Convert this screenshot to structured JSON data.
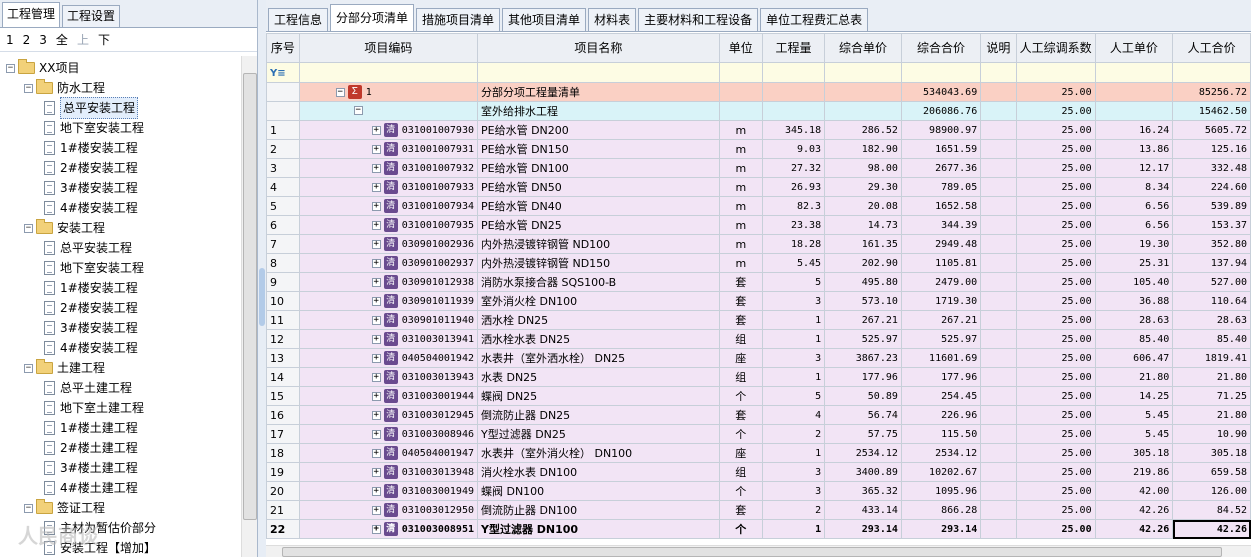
{
  "left_tabs": [
    "工程管理",
    "工程设置"
  ],
  "levels": [
    "1",
    "2",
    "3",
    "全",
    "上",
    "下"
  ],
  "tree": [
    {
      "label": "XX项目",
      "depth": 0,
      "type": "folder",
      "exp": "−"
    },
    {
      "label": "防水工程",
      "depth": 1,
      "type": "folder",
      "exp": "−"
    },
    {
      "label": "总平安装工程",
      "depth": 2,
      "type": "doc",
      "selected": true
    },
    {
      "label": "地下室安装工程",
      "depth": 2,
      "type": "doc"
    },
    {
      "label": "1#楼安装工程",
      "depth": 2,
      "type": "doc"
    },
    {
      "label": "2#楼安装工程",
      "depth": 2,
      "type": "doc"
    },
    {
      "label": "3#楼安装工程",
      "depth": 2,
      "type": "doc"
    },
    {
      "label": "4#楼安装工程",
      "depth": 2,
      "type": "doc"
    },
    {
      "label": "安装工程",
      "depth": 1,
      "type": "folder",
      "exp": "−"
    },
    {
      "label": "总平安装工程",
      "depth": 2,
      "type": "doc"
    },
    {
      "label": "地下室安装工程",
      "depth": 2,
      "type": "doc"
    },
    {
      "label": "1#楼安装工程",
      "depth": 2,
      "type": "doc"
    },
    {
      "label": "2#楼安装工程",
      "depth": 2,
      "type": "doc"
    },
    {
      "label": "3#楼安装工程",
      "depth": 2,
      "type": "doc"
    },
    {
      "label": "4#楼安装工程",
      "depth": 2,
      "type": "doc"
    },
    {
      "label": "土建工程",
      "depth": 1,
      "type": "folder",
      "exp": "−"
    },
    {
      "label": "总平土建工程",
      "depth": 2,
      "type": "doc"
    },
    {
      "label": "地下室土建工程",
      "depth": 2,
      "type": "doc"
    },
    {
      "label": "1#楼土建工程",
      "depth": 2,
      "type": "doc"
    },
    {
      "label": "2#楼土建工程",
      "depth": 2,
      "type": "doc"
    },
    {
      "label": "3#楼土建工程",
      "depth": 2,
      "type": "doc"
    },
    {
      "label": "4#楼土建工程",
      "depth": 2,
      "type": "doc"
    },
    {
      "label": "签证工程",
      "depth": 1,
      "type": "folder",
      "exp": "−"
    },
    {
      "label": "主材为暂估价部分",
      "depth": 2,
      "type": "doc"
    },
    {
      "label": "安装工程【增加】",
      "depth": 2,
      "type": "doc"
    }
  ],
  "right_tabs": [
    "工程信息",
    "分部分项清单",
    "措施项目清单",
    "其他项目清单",
    "材料表",
    "主要材料和工程设备",
    "单位工程费汇总表"
  ],
  "active_right_tab": 1,
  "columns": [
    "序号",
    "项目编码",
    "项目名称",
    "单位",
    "工程量",
    "综合单价",
    "综合合价",
    "说明",
    "人工综调系数",
    "人工单价",
    "人工合价"
  ],
  "summary_rows": [
    {
      "idx": "",
      "code": "1",
      "name": "分部分项工程量清单",
      "unit": "",
      "qty": "",
      "price": "",
      "total": "534043.69",
      "note": "",
      "coef": "25.00",
      "lprice": "",
      "ltotal": "85256.72"
    },
    {
      "idx": "",
      "code": "",
      "name": "室外给排水工程",
      "unit": "",
      "qty": "",
      "price": "",
      "total": "206086.76",
      "note": "",
      "coef": "25.00",
      "lprice": "",
      "ltotal": "15462.50"
    }
  ],
  "rows": [
    {
      "idx": "1",
      "code": "031001007930",
      "name": "PE给水管 DN200",
      "unit": "m",
      "qty": "345.18",
      "price": "286.52",
      "total": "98900.97",
      "note": "",
      "coef": "25.00",
      "lprice": "16.24",
      "ltotal": "5605.72"
    },
    {
      "idx": "2",
      "code": "031001007931",
      "name": "PE给水管 DN150",
      "unit": "m",
      "qty": "9.03",
      "price": "182.90",
      "total": "1651.59",
      "note": "",
      "coef": "25.00",
      "lprice": "13.86",
      "ltotal": "125.16"
    },
    {
      "idx": "3",
      "code": "031001007932",
      "name": "PE给水管 DN100",
      "unit": "m",
      "qty": "27.32",
      "price": "98.00",
      "total": "2677.36",
      "note": "",
      "coef": "25.00",
      "lprice": "12.17",
      "ltotal": "332.48"
    },
    {
      "idx": "4",
      "code": "031001007933",
      "name": "PE给水管 DN50",
      "unit": "m",
      "qty": "26.93",
      "price": "29.30",
      "total": "789.05",
      "note": "",
      "coef": "25.00",
      "lprice": "8.34",
      "ltotal": "224.60"
    },
    {
      "idx": "5",
      "code": "031001007934",
      "name": "PE给水管 DN40",
      "unit": "m",
      "qty": "82.3",
      "price": "20.08",
      "total": "1652.58",
      "note": "",
      "coef": "25.00",
      "lprice": "6.56",
      "ltotal": "539.89"
    },
    {
      "idx": "6",
      "code": "031001007935",
      "name": "PE给水管 DN25",
      "unit": "m",
      "qty": "23.38",
      "price": "14.73",
      "total": "344.39",
      "note": "",
      "coef": "25.00",
      "lprice": "6.56",
      "ltotal": "153.37"
    },
    {
      "idx": "7",
      "code": "030901002936",
      "name": "内外热浸镀锌钢管 ND100",
      "unit": "m",
      "qty": "18.28",
      "price": "161.35",
      "total": "2949.48",
      "note": "",
      "coef": "25.00",
      "lprice": "19.30",
      "ltotal": "352.80"
    },
    {
      "idx": "8",
      "code": "030901002937",
      "name": "内外热浸镀锌钢管 ND150",
      "unit": "m",
      "qty": "5.45",
      "price": "202.90",
      "total": "1105.81",
      "note": "",
      "coef": "25.00",
      "lprice": "25.31",
      "ltotal": "137.94"
    },
    {
      "idx": "9",
      "code": "030901012938",
      "name": "消防水泵接合器 SQS100-B",
      "unit": "套",
      "qty": "5",
      "price": "495.80",
      "total": "2479.00",
      "note": "",
      "coef": "25.00",
      "lprice": "105.40",
      "ltotal": "527.00"
    },
    {
      "idx": "10",
      "code": "030901011939",
      "name": "室外消火栓 DN100",
      "unit": "套",
      "qty": "3",
      "price": "573.10",
      "total": "1719.30",
      "note": "",
      "coef": "25.00",
      "lprice": "36.88",
      "ltotal": "110.64"
    },
    {
      "idx": "11",
      "code": "030901011940",
      "name": "洒水栓 DN25",
      "unit": "套",
      "qty": "1",
      "price": "267.21",
      "total": "267.21",
      "note": "",
      "coef": "25.00",
      "lprice": "28.63",
      "ltotal": "28.63"
    },
    {
      "idx": "12",
      "code": "031003013941",
      "name": "洒水栓水表 DN25",
      "unit": "组",
      "qty": "1",
      "price": "525.97",
      "total": "525.97",
      "note": "",
      "coef": "25.00",
      "lprice": "85.40",
      "ltotal": "85.40"
    },
    {
      "idx": "13",
      "code": "040504001942",
      "name": "水表井（室外洒水栓） DN25",
      "unit": "座",
      "qty": "3",
      "price": "3867.23",
      "total": "11601.69",
      "note": "",
      "coef": "25.00",
      "lprice": "606.47",
      "ltotal": "1819.41"
    },
    {
      "idx": "14",
      "code": "031003013943",
      "name": "水表 DN25",
      "unit": "组",
      "qty": "1",
      "price": "177.96",
      "total": "177.96",
      "note": "",
      "coef": "25.00",
      "lprice": "21.80",
      "ltotal": "21.80"
    },
    {
      "idx": "15",
      "code": "031003001944",
      "name": "蝶阀 DN25",
      "unit": "个",
      "qty": "5",
      "price": "50.89",
      "total": "254.45",
      "note": "",
      "coef": "25.00",
      "lprice": "14.25",
      "ltotal": "71.25"
    },
    {
      "idx": "16",
      "code": "031003012945",
      "name": "倒流防止器 DN25",
      "unit": "套",
      "qty": "4",
      "price": "56.74",
      "total": "226.96",
      "note": "",
      "coef": "25.00",
      "lprice": "5.45",
      "ltotal": "21.80"
    },
    {
      "idx": "17",
      "code": "031003008946",
      "name": "Y型过滤器 DN25",
      "unit": "个",
      "qty": "2",
      "price": "57.75",
      "total": "115.50",
      "note": "",
      "coef": "25.00",
      "lprice": "5.45",
      "ltotal": "10.90"
    },
    {
      "idx": "18",
      "code": "040504001947",
      "name": "水表井（室外消火栓） DN100",
      "unit": "座",
      "qty": "1",
      "price": "2534.12",
      "total": "2534.12",
      "note": "",
      "coef": "25.00",
      "lprice": "305.18",
      "ltotal": "305.18"
    },
    {
      "idx": "19",
      "code": "031003013948",
      "name": "消火栓水表 DN100",
      "unit": "组",
      "qty": "3",
      "price": "3400.89",
      "total": "10202.67",
      "note": "",
      "coef": "25.00",
      "lprice": "219.86",
      "ltotal": "659.58"
    },
    {
      "idx": "20",
      "code": "031003001949",
      "name": "蝶阀 DN100",
      "unit": "个",
      "qty": "3",
      "price": "365.32",
      "total": "1095.96",
      "note": "",
      "coef": "25.00",
      "lprice": "42.00",
      "ltotal": "126.00"
    },
    {
      "idx": "21",
      "code": "031003012950",
      "name": "倒流防止器 DN100",
      "unit": "套",
      "qty": "2",
      "price": "433.14",
      "total": "866.28",
      "note": "",
      "coef": "25.00",
      "lprice": "42.26",
      "ltotal": "84.52"
    },
    {
      "idx": "22",
      "code": "031003008951",
      "name": "Y型过滤器 DN100",
      "unit": "个",
      "qty": "1",
      "price": "293.14",
      "total": "293.14",
      "note": "",
      "coef": "25.00",
      "lprice": "42.26",
      "ltotal": "42.26",
      "bold": true
    }
  ],
  "watermark": "人民商谈"
}
